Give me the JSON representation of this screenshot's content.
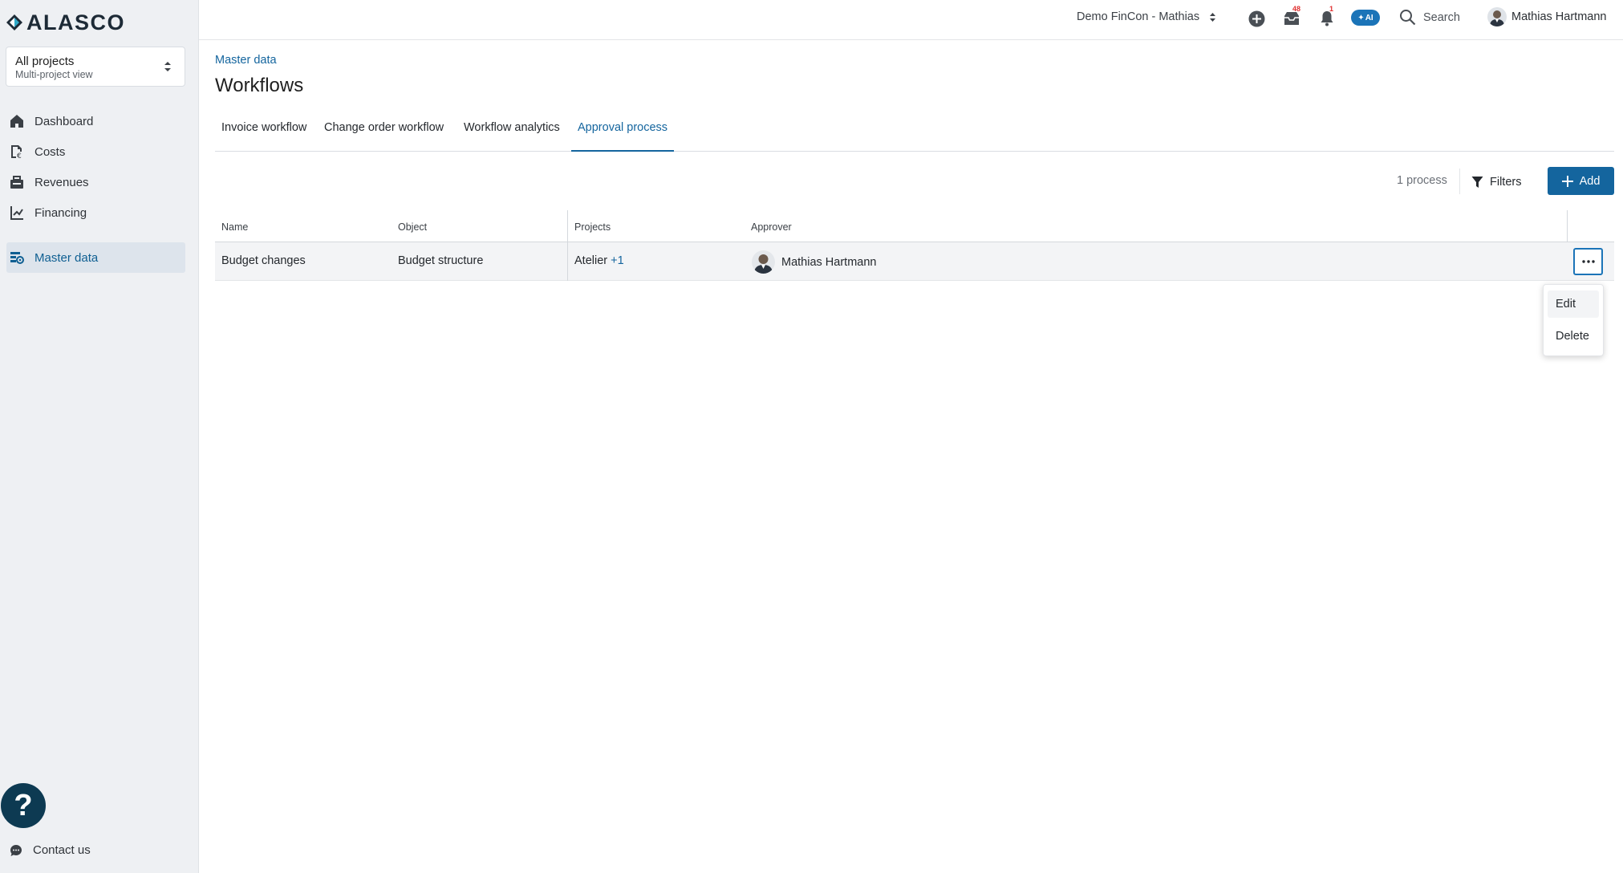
{
  "app": {
    "logo_text": "ALASCO",
    "brand_color": "#14659e"
  },
  "project_selector": {
    "title": "All projects",
    "subtitle": "Multi-project view"
  },
  "sidebar": {
    "items": [
      {
        "label": "Dashboard",
        "icon": "home-icon"
      },
      {
        "label": "Costs",
        "icon": "costs-icon"
      },
      {
        "label": "Revenues",
        "icon": "revenues-icon"
      },
      {
        "label": "Financing",
        "icon": "financing-icon"
      },
      {
        "label": "Master data",
        "icon": "master-data-icon",
        "active": true
      }
    ],
    "contact_label": "Contact us",
    "help_label": "?"
  },
  "topbar": {
    "company_label": "Demo FinCon - Mathias",
    "inbox_badge": "48",
    "notification_badge": "1",
    "ai_label": "AI",
    "search_label": "Search",
    "user_name": "Mathias Hartmann"
  },
  "page": {
    "breadcrumb": "Master data",
    "title": "Workflows",
    "tabs": [
      {
        "label": "Invoice workflow"
      },
      {
        "label": "Change order workflow"
      },
      {
        "label": "Workflow analytics"
      },
      {
        "label": "Approval process",
        "active": true
      }
    ]
  },
  "toolbar": {
    "count_label": "1 process",
    "filters_label": "Filters",
    "add_label": "Add"
  },
  "table": {
    "columns": [
      "Name",
      "Object",
      "Projects",
      "Approver"
    ],
    "rows": [
      {
        "name": "Budget changes",
        "object": "Budget structure",
        "projects": "Atelier",
        "projects_extra": "+1",
        "approver": "Mathias Hartmann"
      }
    ]
  },
  "row_menu": {
    "items": [
      "Edit",
      "Delete"
    ]
  }
}
